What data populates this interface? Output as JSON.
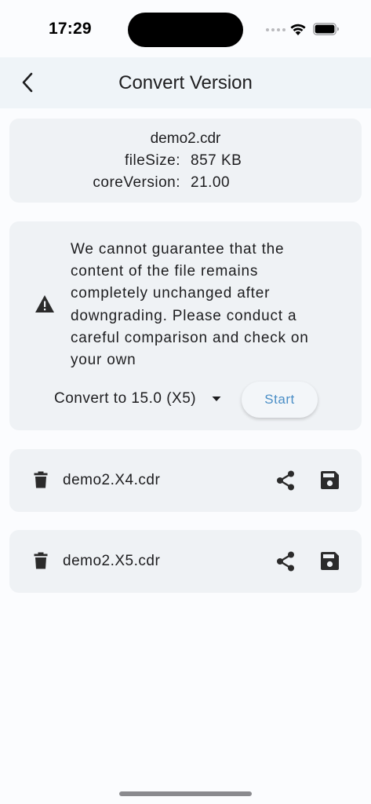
{
  "status_bar": {
    "time": "17:29"
  },
  "app_bar": {
    "title": "Convert Version"
  },
  "file_info": {
    "name": "demo2.cdr",
    "file_size_label": "fileSize:",
    "file_size_value": "857 KB",
    "core_version_label": "coreVersion:",
    "core_version_value": "21.00"
  },
  "warning": {
    "lines": [
      "We cannot guarantee that the",
      "content of the file remains",
      "completely unchanged after",
      "downgrading. Please conduct a",
      "careful comparison and check on",
      "your own"
    ],
    "convert_selected": "Convert to 15.0 (X5)",
    "start_label": "Start"
  },
  "files": [
    {
      "name": "demo2.X4.cdr"
    },
    {
      "name": "demo2.X5.cdr"
    }
  ],
  "colors": {
    "accent": "#4a8ec6",
    "card_bg": "#eff2f5",
    "app_bar_bg": "#eff4f8"
  }
}
